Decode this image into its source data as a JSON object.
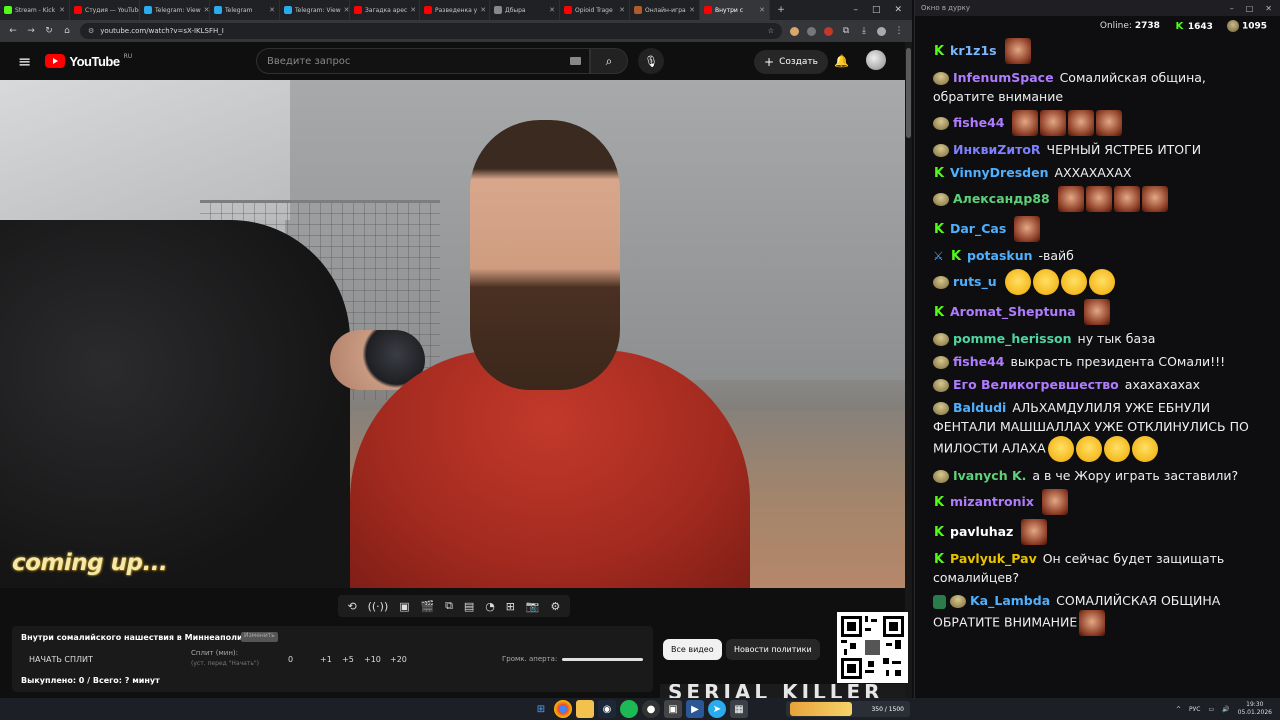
{
  "browser": {
    "tabs": [
      {
        "title": "Stream - Kick",
        "color": "#53fc18"
      },
      {
        "title": "Студия — YouTube",
        "color": "#ff0000"
      },
      {
        "title": "Telegram: View",
        "color": "#2aabee"
      },
      {
        "title": "Telegram",
        "color": "#2aabee"
      },
      {
        "title": "Telegram: View",
        "color": "#2aabee"
      },
      {
        "title": "Загадка арес",
        "color": "#ff0000"
      },
      {
        "title": "Разведенка у",
        "color": "#ff0000"
      },
      {
        "title": "Дбыра",
        "color": "#888888"
      },
      {
        "title": "Opioid Trage",
        "color": "#ff0000"
      },
      {
        "title": "Онлайн-игра",
        "color": "#b05c2b"
      },
      {
        "title": "Внутри с",
        "color": "#ff0000",
        "active": true
      }
    ],
    "url": "youtube.com/watch?v=sX-IKLSFH_I"
  },
  "youtube": {
    "logo_text": "YouTube",
    "region": "RU",
    "search_placeholder": "Введите запрос",
    "create_label": "Создать"
  },
  "video": {
    "overlay_text": "coming up..."
  },
  "split_panel": {
    "title": "Внутри сомалийского нашествия в Миннеаполисе...",
    "badge": "Изменить",
    "start_button": "НАЧАТЬ СПЛИТ",
    "split_label": "Сплит (мин):",
    "split_hint": "(уст. перед \"Начать\")",
    "split_value": "0",
    "increments": [
      "+1",
      "+5",
      "+10",
      "+20"
    ],
    "volume_label": "Громк. аперта:",
    "bought": "Выкуплено: 0 / Всего: ? минут"
  },
  "chips": {
    "all_videos": "Все видео",
    "news": "Новости политики"
  },
  "thumbnail_text": "SERIAL KILLER",
  "chat": {
    "window_title": "Окно в дурку",
    "online_label": "Online:",
    "online_count": "2738",
    "kick_count": "1643",
    "sub_count": "1095",
    "messages": [
      {
        "badges": [
          "kick"
        ],
        "user": "kr1z1s",
        "color": "#7ab8ff",
        "text": "",
        "emotes": 1,
        "emote": "face"
      },
      {
        "badges": [
          "sub"
        ],
        "user": "InfenumSpace",
        "color": "#b07cff",
        "text": "Сомалийская община, обратите внимание",
        "emotes": 0
      },
      {
        "badges": [
          "sub"
        ],
        "user": "fishe44",
        "color": "#b07cff",
        "text": "",
        "emotes": 4,
        "emote": "face"
      },
      {
        "badges": [
          "sub"
        ],
        "user": "ИнквиZитоR",
        "color": "#7f7fff",
        "text": "ЧЕРНЫЙ ЯСТРЕБ ИТОГИ",
        "emotes": 0
      },
      {
        "badges": [
          "kick"
        ],
        "user": "VinnyDresden",
        "color": "#4fb0ff",
        "text": "АХХАХАХАХ",
        "emotes": 0
      },
      {
        "badges": [
          "sub"
        ],
        "user": "Александр88",
        "color": "#5fd07a",
        "text": "",
        "emotes": 4,
        "emote": "face"
      },
      {
        "badges": [
          "kick"
        ],
        "user": "Dar_Cas",
        "color": "#4fb0ff",
        "text": "",
        "emotes": 1,
        "emote": "face"
      },
      {
        "badges": [
          "sword",
          "kick"
        ],
        "user": "potaskun",
        "color": "#4fb0ff",
        "text": "-вайб",
        "emotes": 0
      },
      {
        "badges": [
          "sub"
        ],
        "user": "ruts_u",
        "color": "#4fb0ff",
        "text": "",
        "emotes": 4,
        "emote": "laugh"
      },
      {
        "badges": [
          "kick"
        ],
        "user": "Aromat_Sheptuna",
        "color": "#b07cff",
        "text": "",
        "emotes": 1,
        "emote": "face"
      },
      {
        "badges": [
          "sub"
        ],
        "user": "pomme_herisson",
        "color": "#4fd6a0",
        "text": "ну тык база",
        "emotes": 0
      },
      {
        "badges": [
          "sub"
        ],
        "user": "fishe44",
        "color": "#b07cff",
        "text": "выкрасть президента СОмали!!!",
        "emotes": 0
      },
      {
        "badges": [
          "sub"
        ],
        "user": "Его Великогревшество",
        "color": "#b07cff",
        "text": "ахахахахах",
        "emotes": 0
      },
      {
        "badges": [
          "sub"
        ],
        "user": "Baldudi",
        "color": "#4fb0ff",
        "text": "АЛЬХАМДУЛИЛЯ УЖЕ ЕБНУЛИ ФЕНТАЛИ МАШШАЛЛАХ УЖЕ ОТКЛИНУЛИСЬ ПО МИЛОСТИ АЛАХА",
        "emotes": 4,
        "emote": "laugh"
      },
      {
        "badges": [
          "sub"
        ],
        "user": "Ivanych K.",
        "color": "#5fd07a",
        "text": "а в че Жору играть заставили?",
        "emotes": 0
      },
      {
        "badges": [
          "kick"
        ],
        "user": "mizantronix",
        "color": "#b07cff",
        "text": "",
        "emotes": 1,
        "emote": "face"
      },
      {
        "badges": [
          "kick"
        ],
        "user": "pavluhaz",
        "color": "#ffffff",
        "text": "",
        "emotes": 1,
        "emote": "face"
      },
      {
        "badges": [
          "kick"
        ],
        "user": "Pavlyuk_Pav",
        "color": "#e6c200",
        "text": "Он сейчас будет защищать сомалийцев?",
        "emotes": 0
      },
      {
        "badges": [
          "shield",
          "sub"
        ],
        "user": "Ka_Lambda",
        "color": "#4fb0ff",
        "text": "СОМАЛИЙСКАЯ ОБЩИНА ОБРАТИТЕ ВНИМАНИЕ",
        "emotes": 1,
        "emote": "face"
      }
    ]
  },
  "taskbar": {
    "tray_lang": "РУС",
    "time": "19:30",
    "date": "05.01.2026",
    "widget_text": "350 / 1500"
  }
}
